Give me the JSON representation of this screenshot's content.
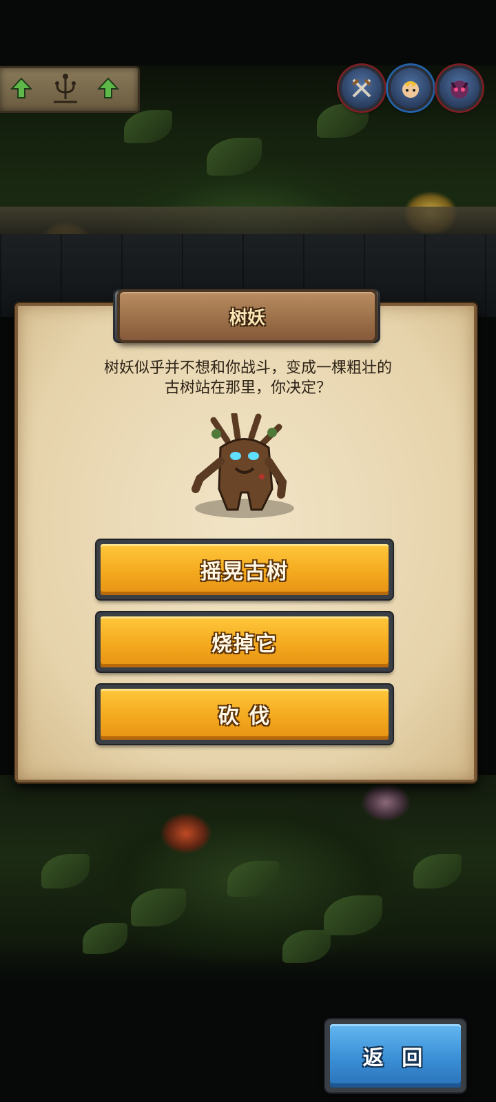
{
  "event": {
    "title": "树妖",
    "description_line1": "树妖似乎并不想和你战斗，变成一棵粗壮的",
    "description_line2": "古树站在那里，你决定？",
    "character_icon": "treant-icon"
  },
  "options": [
    {
      "label": "摇晃古树"
    },
    {
      "label": "烧掉它"
    },
    {
      "label": "砍 伐"
    }
  ],
  "back_label": "返 回",
  "top_bar": {
    "left_icons": [
      "arrow-up-icon",
      "candelabra-icon",
      "arrow-up-icon"
    ],
    "right_icons": [
      "crossed-axes-icon",
      "hero-portrait-icon",
      "monster-portrait-icon"
    ]
  },
  "colors": {
    "option_button": "#f4a91e",
    "back_button": "#3a8fd6",
    "panel": "#e6d3ab"
  }
}
